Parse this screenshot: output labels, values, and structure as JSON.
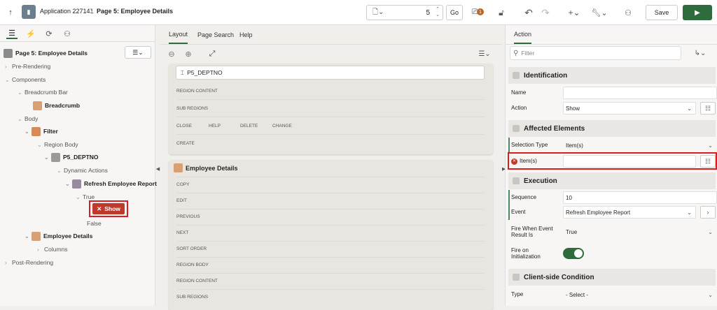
{
  "topbar": {
    "app_title": "Application 227141",
    "page_title": "Page 5: Employee Details",
    "page_number": "5",
    "go_label": "Go",
    "badge_count": "1",
    "save_label": "Save"
  },
  "left": {
    "page_title": "Page 5: Employee Details",
    "tree": {
      "pre_rendering": "Pre-Rendering",
      "components": "Components",
      "breadcrumb_bar": "Breadcrumb Bar",
      "breadcrumb": "Breadcrumb",
      "body": "Body",
      "filter": "Filter",
      "region_body": "Region Body",
      "p5_deptno": "P5_DEPTNO",
      "dynamic_actions": "Dynamic Actions",
      "refresh": "Refresh Employee Report",
      "true_label": "True",
      "show": "Show",
      "false_label": "False",
      "employee_details": "Employee Details",
      "columns": "Columns",
      "post_rendering": "Post-Rendering"
    }
  },
  "mid": {
    "tabs": [
      "Layout",
      "Page Search",
      "Help"
    ],
    "item": "P5_DEPTNO",
    "filter_labels": {
      "region_content": "REGION CONTENT",
      "sub_regions": "SUB REGIONS",
      "close": "CLOSE",
      "help": "HELP",
      "delete": "DELETE",
      "change": "CHANGE",
      "create": "CREATE"
    },
    "emp_title": "Employee Details",
    "emp_labels": [
      "COPY",
      "EDIT",
      "PREVIOUS",
      "NEXT",
      "SORT ORDER",
      "REGION BODY",
      "REGION CONTENT",
      "SUB REGIONS"
    ]
  },
  "right": {
    "tab": "Action",
    "filter_placeholder": "Filter",
    "identification": "Identification",
    "name_label": "Name",
    "action_label": "Action",
    "action_value": "Show",
    "affected": "Affected Elements",
    "selection_type_label": "Selection Type",
    "selection_type_value": "Item(s)",
    "items_label": "Item(s)",
    "execution": "Execution",
    "sequence_label": "Sequence",
    "sequence_value": "10",
    "event_label": "Event",
    "event_value": "Refresh Employee Report",
    "fire_when_label": "Fire When Event Result Is",
    "fire_when_value": "True",
    "fire_init_label": "Fire on Initialization",
    "client_cond": "Client-side Condition",
    "type_label": "Type",
    "type_value": "- Select -"
  },
  "colors": {
    "accent": "#2e6b3d",
    "highlight": "#d81e25",
    "show_node": "#c0392b"
  }
}
